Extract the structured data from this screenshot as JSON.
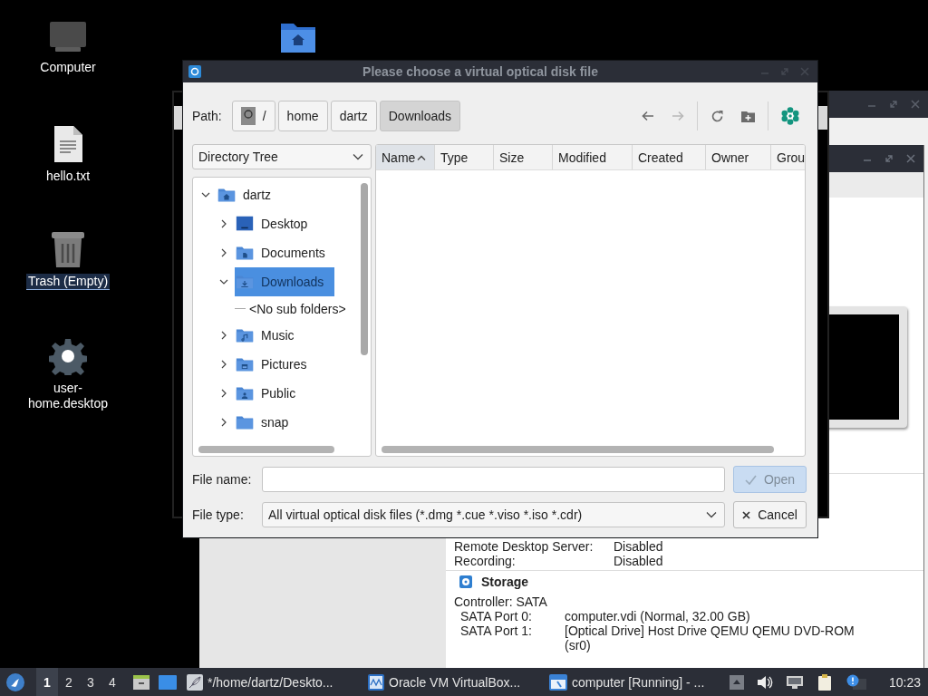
{
  "desktop_icons": [
    {
      "kind": "computer",
      "label": "Computer",
      "selected": false
    },
    {
      "kind": "home-folder",
      "selected": false
    },
    {
      "kind": "text-file",
      "label": "hello.txt",
      "selected": false
    },
    {
      "kind": "trash",
      "label": "Trash (Empty)",
      "selected": true
    },
    {
      "kind": "settings-file",
      "label": "user-home.desktop",
      "selected": false
    }
  ],
  "dialog": {
    "title": "Please choose a virtual optical disk file",
    "path_label": "Path:",
    "crumbs": [
      {
        "kind": "root",
        "label": "/",
        "selected": false
      },
      {
        "kind": "folder",
        "label": "home",
        "selected": false
      },
      {
        "kind": "folder",
        "label": "dartz",
        "selected": false
      },
      {
        "kind": "folder",
        "label": "Downloads",
        "selected": true
      }
    ],
    "toolbar": [
      {
        "kind": "back",
        "disabled": false
      },
      {
        "kind": "forward",
        "disabled": true
      },
      {
        "kind": "refresh",
        "disabled": false
      },
      {
        "kind": "new-folder",
        "disabled": false
      },
      {
        "kind": "options",
        "disabled": false
      }
    ],
    "view_mode": "Directory Tree",
    "tree": {
      "kind": "home",
      "label": "dartz",
      "expanded": true,
      "selected": false,
      "children": [
        {
          "kind": "desktop",
          "label": "Desktop",
          "expanded": false,
          "selected": false
        },
        {
          "kind": "documents",
          "label": "Documents",
          "expanded": false,
          "selected": false
        },
        {
          "kind": "download",
          "label": "Downloads",
          "expanded": true,
          "selected": true,
          "children": [
            {
              "kind": "placeholder",
              "label": "<No sub folders>"
            }
          ]
        },
        {
          "kind": "music",
          "label": "Music",
          "expanded": false,
          "selected": false
        },
        {
          "kind": "pictures",
          "label": "Pictures",
          "expanded": false,
          "selected": false
        },
        {
          "kind": "public",
          "label": "Public",
          "expanded": false,
          "selected": false
        },
        {
          "kind": "plain",
          "label": "snap",
          "expanded": false,
          "selected": false
        }
      ]
    },
    "columns": [
      {
        "label": "Name",
        "sorted": true
      },
      {
        "label": "Type",
        "sorted": false
      },
      {
        "label": "Size",
        "sorted": false
      },
      {
        "label": "Modified",
        "sorted": false
      },
      {
        "label": "Created",
        "sorted": false
      },
      {
        "label": "Owner",
        "sorted": false
      },
      {
        "label": "Grou",
        "sorted": false
      }
    ],
    "file_name": {
      "label": "File name:"
    },
    "file_type": {
      "label": "File type:",
      "value": "All virtual optical disk files (*.dmg *.cue *.viso *.iso *.cdr)"
    },
    "buttons": [
      {
        "kind": "open",
        "label": "Open",
        "disabled": true
      },
      {
        "kind": "cancel",
        "label": "Cancel",
        "disabled": false
      }
    ]
  },
  "vm_details": {
    "rows": [
      {
        "label": "Remote Desktop Server:",
        "value": "Disabled"
      },
      {
        "label": "Recording:",
        "value": "Disabled"
      }
    ],
    "storage": {
      "title": "Storage",
      "lines": [
        {
          "label": "Controller: SATA"
        },
        {
          "label": "SATA Port 0:",
          "value": "computer.vdi (Normal, 32.00 GB)"
        },
        {
          "label": "SATA Port 1:",
          "value": "[Optical Drive] Host Drive QEMU QEMU DVD-ROM (sr0)"
        }
      ]
    }
  },
  "taskbar": {
    "workspaces": [
      {
        "label": "1",
        "selected": true
      },
      {
        "label": "2",
        "selected": false
      },
      {
        "label": "3",
        "selected": false
      },
      {
        "label": "4",
        "selected": false
      }
    ],
    "launchers": [
      {
        "kind": "file-manager"
      },
      {
        "kind": "desktop"
      }
    ],
    "tasks": [
      {
        "kind": "text-editor",
        "label": "*/home/dartz/Deskto...",
        "selected": false
      },
      {
        "kind": "virtualbox",
        "label": "Oracle VM VirtualBox...",
        "selected": false
      },
      {
        "kind": "vm",
        "label": "computer [Running] - ...",
        "selected": false
      }
    ],
    "clock": "10:23"
  }
}
